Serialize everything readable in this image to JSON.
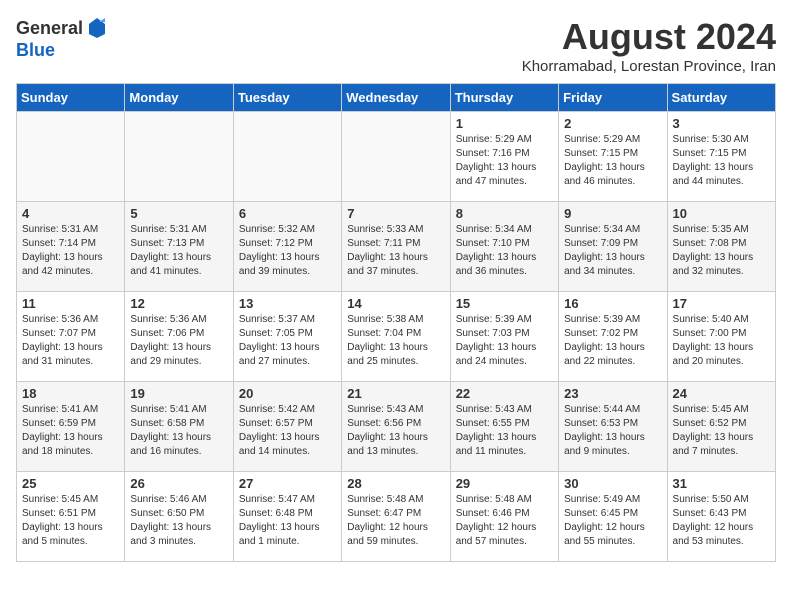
{
  "header": {
    "logo_general": "General",
    "logo_blue": "Blue",
    "month_year": "August 2024",
    "location": "Khorramabad, Lorestan Province, Iran"
  },
  "weekdays": [
    "Sunday",
    "Monday",
    "Tuesday",
    "Wednesday",
    "Thursday",
    "Friday",
    "Saturday"
  ],
  "weeks": [
    [
      {
        "day": "",
        "info": ""
      },
      {
        "day": "",
        "info": ""
      },
      {
        "day": "",
        "info": ""
      },
      {
        "day": "",
        "info": ""
      },
      {
        "day": "1",
        "info": "Sunrise: 5:29 AM\nSunset: 7:16 PM\nDaylight: 13 hours\nand 47 minutes."
      },
      {
        "day": "2",
        "info": "Sunrise: 5:29 AM\nSunset: 7:15 PM\nDaylight: 13 hours\nand 46 minutes."
      },
      {
        "day": "3",
        "info": "Sunrise: 5:30 AM\nSunset: 7:15 PM\nDaylight: 13 hours\nand 44 minutes."
      }
    ],
    [
      {
        "day": "4",
        "info": "Sunrise: 5:31 AM\nSunset: 7:14 PM\nDaylight: 13 hours\nand 42 minutes."
      },
      {
        "day": "5",
        "info": "Sunrise: 5:31 AM\nSunset: 7:13 PM\nDaylight: 13 hours\nand 41 minutes."
      },
      {
        "day": "6",
        "info": "Sunrise: 5:32 AM\nSunset: 7:12 PM\nDaylight: 13 hours\nand 39 minutes."
      },
      {
        "day": "7",
        "info": "Sunrise: 5:33 AM\nSunset: 7:11 PM\nDaylight: 13 hours\nand 37 minutes."
      },
      {
        "day": "8",
        "info": "Sunrise: 5:34 AM\nSunset: 7:10 PM\nDaylight: 13 hours\nand 36 minutes."
      },
      {
        "day": "9",
        "info": "Sunrise: 5:34 AM\nSunset: 7:09 PM\nDaylight: 13 hours\nand 34 minutes."
      },
      {
        "day": "10",
        "info": "Sunrise: 5:35 AM\nSunset: 7:08 PM\nDaylight: 13 hours\nand 32 minutes."
      }
    ],
    [
      {
        "day": "11",
        "info": "Sunrise: 5:36 AM\nSunset: 7:07 PM\nDaylight: 13 hours\nand 31 minutes."
      },
      {
        "day": "12",
        "info": "Sunrise: 5:36 AM\nSunset: 7:06 PM\nDaylight: 13 hours\nand 29 minutes."
      },
      {
        "day": "13",
        "info": "Sunrise: 5:37 AM\nSunset: 7:05 PM\nDaylight: 13 hours\nand 27 minutes."
      },
      {
        "day": "14",
        "info": "Sunrise: 5:38 AM\nSunset: 7:04 PM\nDaylight: 13 hours\nand 25 minutes."
      },
      {
        "day": "15",
        "info": "Sunrise: 5:39 AM\nSunset: 7:03 PM\nDaylight: 13 hours\nand 24 minutes."
      },
      {
        "day": "16",
        "info": "Sunrise: 5:39 AM\nSunset: 7:02 PM\nDaylight: 13 hours\nand 22 minutes."
      },
      {
        "day": "17",
        "info": "Sunrise: 5:40 AM\nSunset: 7:00 PM\nDaylight: 13 hours\nand 20 minutes."
      }
    ],
    [
      {
        "day": "18",
        "info": "Sunrise: 5:41 AM\nSunset: 6:59 PM\nDaylight: 13 hours\nand 18 minutes."
      },
      {
        "day": "19",
        "info": "Sunrise: 5:41 AM\nSunset: 6:58 PM\nDaylight: 13 hours\nand 16 minutes."
      },
      {
        "day": "20",
        "info": "Sunrise: 5:42 AM\nSunset: 6:57 PM\nDaylight: 13 hours\nand 14 minutes."
      },
      {
        "day": "21",
        "info": "Sunrise: 5:43 AM\nSunset: 6:56 PM\nDaylight: 13 hours\nand 13 minutes."
      },
      {
        "day": "22",
        "info": "Sunrise: 5:43 AM\nSunset: 6:55 PM\nDaylight: 13 hours\nand 11 minutes."
      },
      {
        "day": "23",
        "info": "Sunrise: 5:44 AM\nSunset: 6:53 PM\nDaylight: 13 hours\nand 9 minutes."
      },
      {
        "day": "24",
        "info": "Sunrise: 5:45 AM\nSunset: 6:52 PM\nDaylight: 13 hours\nand 7 minutes."
      }
    ],
    [
      {
        "day": "25",
        "info": "Sunrise: 5:45 AM\nSunset: 6:51 PM\nDaylight: 13 hours\nand 5 minutes."
      },
      {
        "day": "26",
        "info": "Sunrise: 5:46 AM\nSunset: 6:50 PM\nDaylight: 13 hours\nand 3 minutes."
      },
      {
        "day": "27",
        "info": "Sunrise: 5:47 AM\nSunset: 6:48 PM\nDaylight: 13 hours\nand 1 minute."
      },
      {
        "day": "28",
        "info": "Sunrise: 5:48 AM\nSunset: 6:47 PM\nDaylight: 12 hours\nand 59 minutes."
      },
      {
        "day": "29",
        "info": "Sunrise: 5:48 AM\nSunset: 6:46 PM\nDaylight: 12 hours\nand 57 minutes."
      },
      {
        "day": "30",
        "info": "Sunrise: 5:49 AM\nSunset: 6:45 PM\nDaylight: 12 hours\nand 55 minutes."
      },
      {
        "day": "31",
        "info": "Sunrise: 5:50 AM\nSunset: 6:43 PM\nDaylight: 12 hours\nand 53 minutes."
      }
    ]
  ]
}
